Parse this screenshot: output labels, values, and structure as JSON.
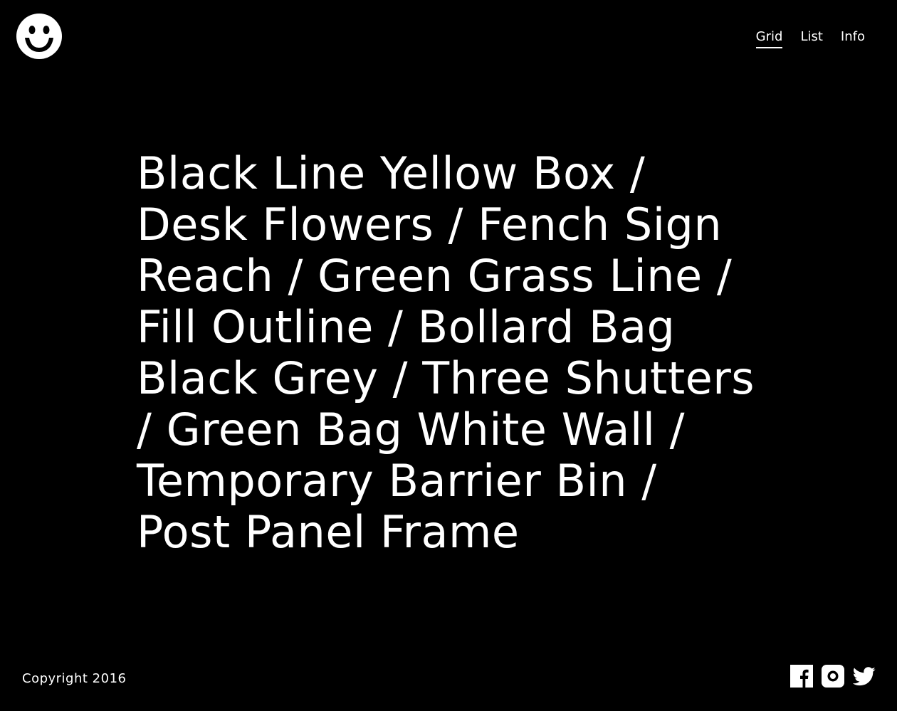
{
  "logo": {
    "icon": "smiley-face-icon"
  },
  "nav": {
    "items": [
      {
        "label": "Grid",
        "active": true
      },
      {
        "label": "List",
        "active": false
      },
      {
        "label": "Info",
        "active": false
      }
    ]
  },
  "projects": [
    "Black Line Yellow Box",
    "Desk Flowers",
    "Fench Sign Reach",
    "Green Grass Line",
    "Fill Outline",
    "Bollard Bag Black Grey",
    "Three Shutters",
    "Green Bag White Wall",
    "Temporary Barrier Bin",
    "Post Panel Frame"
  ],
  "separator": " / ",
  "footer": {
    "copyright": "Copyright 2016",
    "social": [
      {
        "icon": "facebook-icon"
      },
      {
        "icon": "instagram-icon"
      },
      {
        "icon": "twitter-icon"
      }
    ]
  },
  "colors": {
    "background": "#000000",
    "foreground": "#ffffff"
  }
}
